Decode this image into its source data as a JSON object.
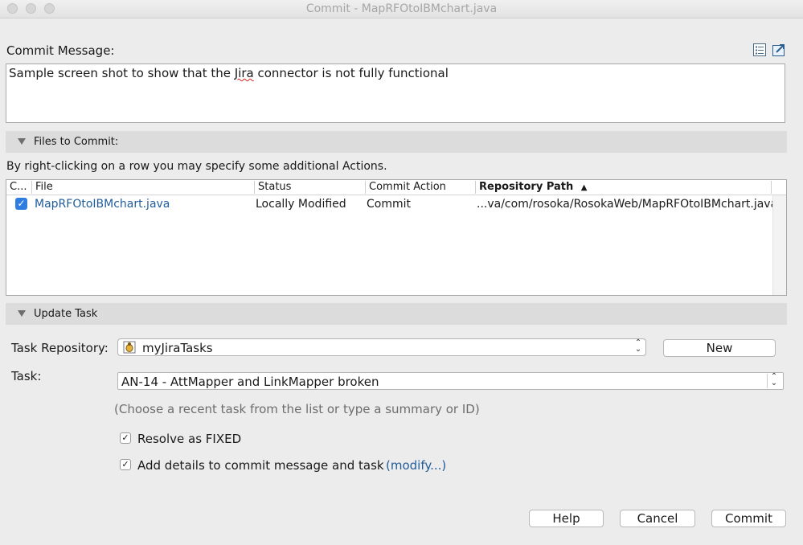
{
  "window": {
    "title": "Commit - MapRFOtoIBMchart.java"
  },
  "commit_message": {
    "label": "Commit Message:",
    "text_before": "Sample screen shot to show that the ",
    "text_misspelled": "Jira",
    "text_after": " connector is not fully functional"
  },
  "files_section": {
    "title": "Files to Commit:",
    "hint": "By right-clicking on a row you may specify some additional Actions.",
    "columns": [
      "C...",
      "File",
      "Status",
      "Commit Action",
      "Repository Path"
    ],
    "sort_indicator": "▲",
    "rows": [
      {
        "checked": true,
        "file": "MapRFOtoIBMchart.java",
        "status": "Locally Modified",
        "action": "Commit",
        "path": "...va/com/rosoka/RosokaWeb/MapRFOtoIBMchart.java"
      }
    ]
  },
  "update_task": {
    "title": "Update Task",
    "repository_label": "Task Repository:",
    "repository_value": "myJiraTasks",
    "new_button": "New",
    "task_label": "Task:",
    "task_value": "AN-14 - AttMapper and LinkMapper broken",
    "task_hint": "(Choose a recent task from the list or type a summary or ID)",
    "resolve_label": "Resolve as FIXED",
    "resolve_checked": true,
    "add_details_label": "Add details to commit message and task",
    "add_details_checked": true,
    "modify_link": "(modify...)"
  },
  "buttons": {
    "help": "Help",
    "cancel": "Cancel",
    "commit": "Commit"
  },
  "colors": {
    "accent": "#2f7de1",
    "link": "#1f5c9a",
    "section_bg": "#dcdcdc"
  }
}
